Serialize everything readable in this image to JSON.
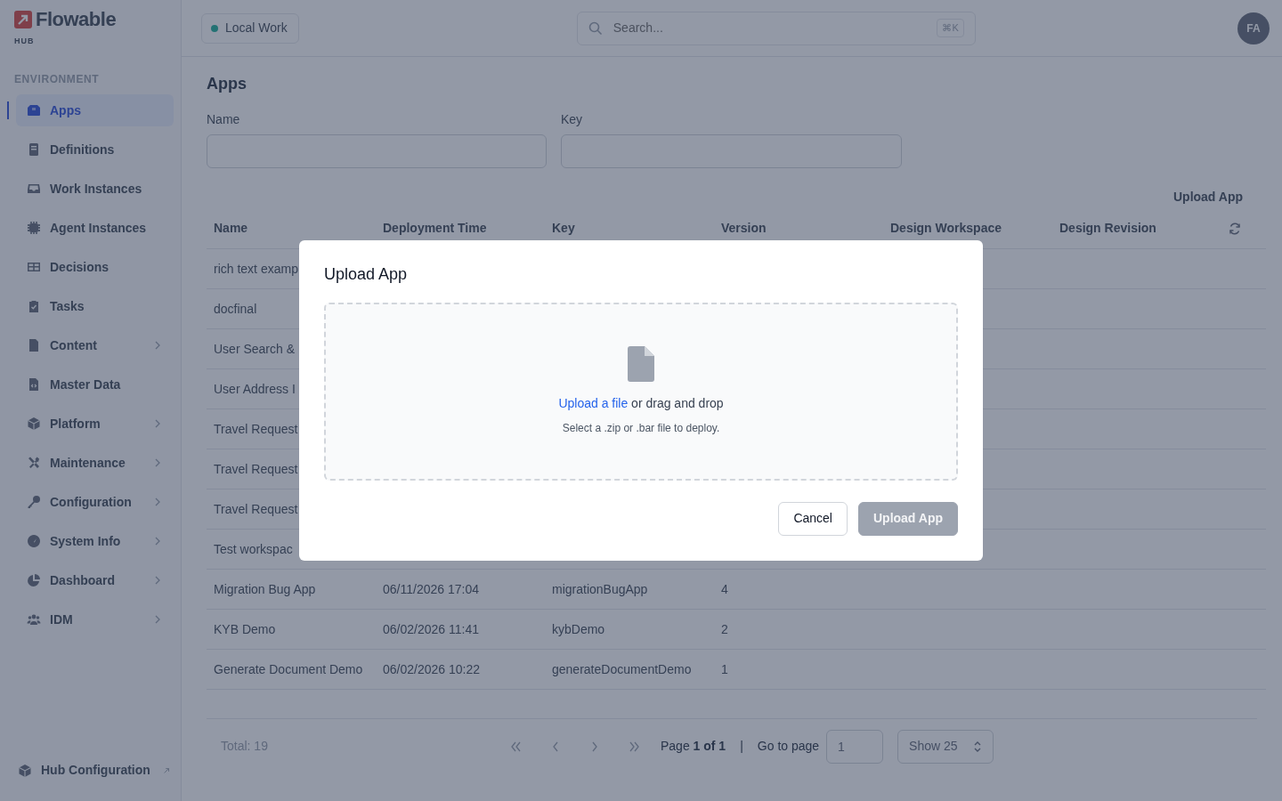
{
  "brand": {
    "name": "Flowable",
    "sub": "HUB"
  },
  "environment": {
    "label": "Local Work"
  },
  "search": {
    "placeholder": "Search...",
    "shortcut": "⌘K"
  },
  "user": {
    "initials": "FA"
  },
  "sidebar": {
    "section": "ENVIRONMENT",
    "items": [
      {
        "label": "Apps",
        "selected": true,
        "expandable": false
      },
      {
        "label": "Definitions",
        "selected": false,
        "expandable": false
      },
      {
        "label": "Work Instances",
        "selected": false,
        "expandable": false
      },
      {
        "label": "Agent Instances",
        "selected": false,
        "expandable": false
      },
      {
        "label": "Decisions",
        "selected": false,
        "expandable": false
      },
      {
        "label": "Tasks",
        "selected": false,
        "expandable": false
      },
      {
        "label": "Content",
        "selected": false,
        "expandable": true
      },
      {
        "label": "Master Data",
        "selected": false,
        "expandable": false
      },
      {
        "label": "Platform",
        "selected": false,
        "expandable": true
      },
      {
        "label": "Maintenance",
        "selected": false,
        "expandable": true
      },
      {
        "label": "Configuration",
        "selected": false,
        "expandable": true
      },
      {
        "label": "System Info",
        "selected": false,
        "expandable": true
      },
      {
        "label": "Dashboard",
        "selected": false,
        "expandable": true
      },
      {
        "label": "IDM",
        "selected": false,
        "expandable": true
      }
    ],
    "footer": {
      "label": "Hub Configuration"
    }
  },
  "page": {
    "title": "Apps",
    "filters": [
      {
        "label": "Name"
      },
      {
        "label": "Key"
      }
    ],
    "action": "Upload App"
  },
  "table": {
    "columns": [
      "Name",
      "Deployment Time",
      "Key",
      "Version",
      "Design Workspace",
      "Design Revision"
    ],
    "rows": [
      [
        "rich text examp"
      ],
      [
        "docfinal"
      ],
      [
        "User Search &"
      ],
      [
        "User Address I"
      ],
      [
        "Travel Request"
      ],
      [
        "Travel Request"
      ],
      [
        "Travel Request"
      ],
      [
        "Test workspac"
      ],
      [
        "Migration Bug App",
        "06/11/2026 17:04",
        "migrationBugApp",
        "4"
      ],
      [
        "KYB Demo",
        "06/02/2026 11:41",
        "kybDemo",
        "2"
      ],
      [
        "Generate Document Demo",
        "06/02/2026 10:22",
        "generateDocumentDemo",
        "1"
      ]
    ]
  },
  "pagination": {
    "total": "Total: 19",
    "page": "Page **1 of 1**",
    "separator": "|",
    "goto_label": "Go to page",
    "goto_value": "1",
    "page_size": "Show 25"
  },
  "modal": {
    "title": "Upload App",
    "link": "Upload a file",
    "instruction": " or drag and drop",
    "hint": "Select a .zip or .bar file to deploy.",
    "buttons": [
      {
        "label": "Cancel",
        "kind": "secondary",
        "disabled": false
      },
      {
        "label": "Upload App",
        "kind": "primary",
        "disabled": true
      }
    ]
  }
}
